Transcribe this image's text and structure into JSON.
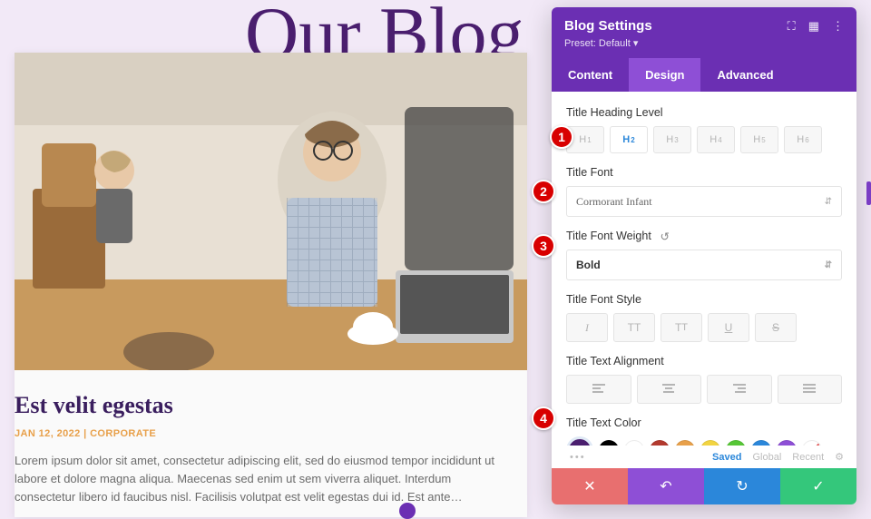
{
  "bg_title": "Our Blog",
  "blog": {
    "title": "Est velit egestas",
    "meta": "JAN 12, 2022 | CORPORATE",
    "excerpt": "Lorem ipsum dolor sit amet, consectetur adipiscing elit, sed do eiusmod tempor incididunt ut labore et dolore magna aliqua. Maecenas sed enim ut sem viverra aliquet. Interdum consectetur libero id faucibus nisl. Facilisis volutpat est velit egestas dui id. Est ante…"
  },
  "panel": {
    "title": "Blog Settings",
    "preset_label": "Preset: Default",
    "tabs": {
      "content": "Content",
      "design": "Design",
      "advanced": "Advanced"
    },
    "labels": {
      "heading_level": "Title Heading Level",
      "title_font": "Title Font",
      "font_weight": "Title Font Weight",
      "font_style": "Title Font Style",
      "alignment": "Title Text Alignment",
      "text_color": "Title Text Color"
    },
    "headings": [
      "H1",
      "H2",
      "H3",
      "H4",
      "H5",
      "H6"
    ],
    "font_value": "Cormorant Infant",
    "weight_value": "Bold",
    "swatches": [
      "#000000",
      "#ffffff",
      "#b33a2f",
      "#e8a04a",
      "#f2d441",
      "#56c636",
      "#2b87da",
      "#8e4fd6"
    ],
    "footer_meta": {
      "saved": "Saved",
      "global": "Global",
      "recent": "Recent"
    }
  },
  "callouts": {
    "c1": "1",
    "c2": "2",
    "c3": "3",
    "c4": "4"
  }
}
